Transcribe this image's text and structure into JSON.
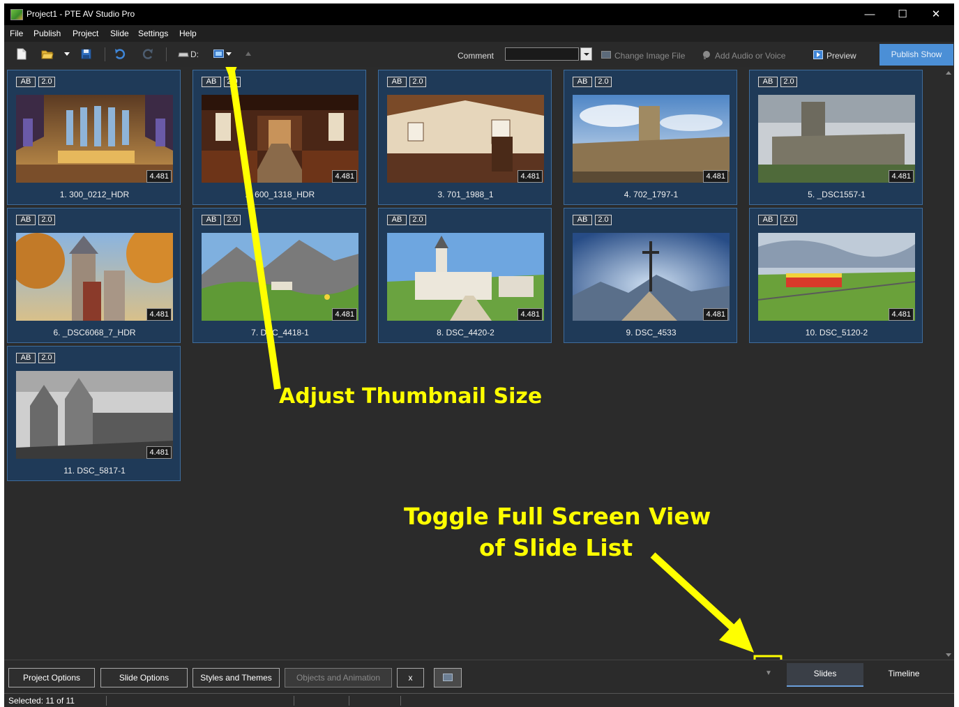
{
  "window": {
    "title": "Project1 - PTE AV Studio Pro",
    "minimize_glyph": "—",
    "maximize_glyph": "☐",
    "close_glyph": "✕"
  },
  "menu": [
    "File",
    "Publish",
    "Project",
    "Slide",
    "Settings",
    "Help"
  ],
  "toolbar": {
    "drive_label": "D:",
    "comment_label": "Comment",
    "comment_value": "",
    "change_image_file": "Change Image File",
    "add_audio": "Add Audio or Voice",
    "preview": "Preview",
    "publish_show": "Publish Show",
    "icons": [
      "new-file-icon",
      "open-folder-icon",
      "dropdown-arrow-icon",
      "save-icon",
      "undo-icon",
      "redo-icon",
      "drive-icon",
      "thumbnail-size-icon",
      "up-arrow-icon"
    ]
  },
  "slides": [
    {
      "badge_ab": "AB",
      "badge_ver": "2.0",
      "duration": "4.481",
      "name": "1. 300_0212_HDR",
      "thumb": "cathedral-interior"
    },
    {
      "badge_ab": "AB",
      "badge_ver": "2.0",
      "duration": "4.481",
      "name": "2. 600_1318_HDR",
      "thumb": "chapel-pews"
    },
    {
      "badge_ab": "AB",
      "badge_ver": "2.0",
      "duration": "4.481",
      "name": "3. 701_1988_1",
      "thumb": "church-interior"
    },
    {
      "badge_ab": "AB",
      "badge_ver": "2.0",
      "duration": "4.481",
      "name": "4. 702_1797-1",
      "thumb": "abbey-exterior"
    },
    {
      "badge_ab": "AB",
      "badge_ver": "2.0",
      "duration": "4.481",
      "name": "5. _DSC1557-1",
      "thumb": "cathedral-exterior"
    },
    {
      "badge_ab": "AB",
      "badge_ver": "2.0",
      "duration": "4.481",
      "name": "6. _DSC6068_7_HDR",
      "thumb": "castle-autumn"
    },
    {
      "badge_ab": "AB",
      "badge_ver": "2.0",
      "duration": "4.481",
      "name": "7. DSC_4418-1",
      "thumb": "alpine-meadow"
    },
    {
      "badge_ab": "AB",
      "badge_ver": "2.0",
      "duration": "4.481",
      "name": "8. DSC_4420-2",
      "thumb": "village-church"
    },
    {
      "badge_ab": "AB",
      "badge_ver": "2.0",
      "duration": "4.481",
      "name": "9. DSC_4533",
      "thumb": "summit-cross"
    },
    {
      "badge_ab": "AB",
      "badge_ver": "2.0",
      "duration": "4.481",
      "name": "10. DSC_5120-2",
      "thumb": "mountain-train"
    },
    {
      "badge_ab": "AB",
      "badge_ver": "2.0",
      "duration": "4.481",
      "name": "11. DSC_5817-1",
      "thumb": "gothic-bw"
    }
  ],
  "annotations": {
    "thumbnail": "Adjust Thumbnail Size",
    "fullscreen_line1": "Toggle Full Screen View",
    "fullscreen_line2": "of Slide List",
    "color": "#ffff00"
  },
  "bottom": {
    "project_options": "Project Options",
    "slide_options": "Slide Options",
    "styles_themes": "Styles and Themes",
    "objects_animation": "Objects and Animation",
    "x_button": "x",
    "toggle_glyph": "▼",
    "tab_slides": "Slides",
    "tab_timeline": "Timeline"
  },
  "status": {
    "selected": "Selected: 11 of 11"
  },
  "colors": {
    "accent": "#4b8fd6",
    "slide_bg": "#1f3a58",
    "slide_border": "#3f6d9c",
    "app_bg": "#2b2b2b"
  }
}
